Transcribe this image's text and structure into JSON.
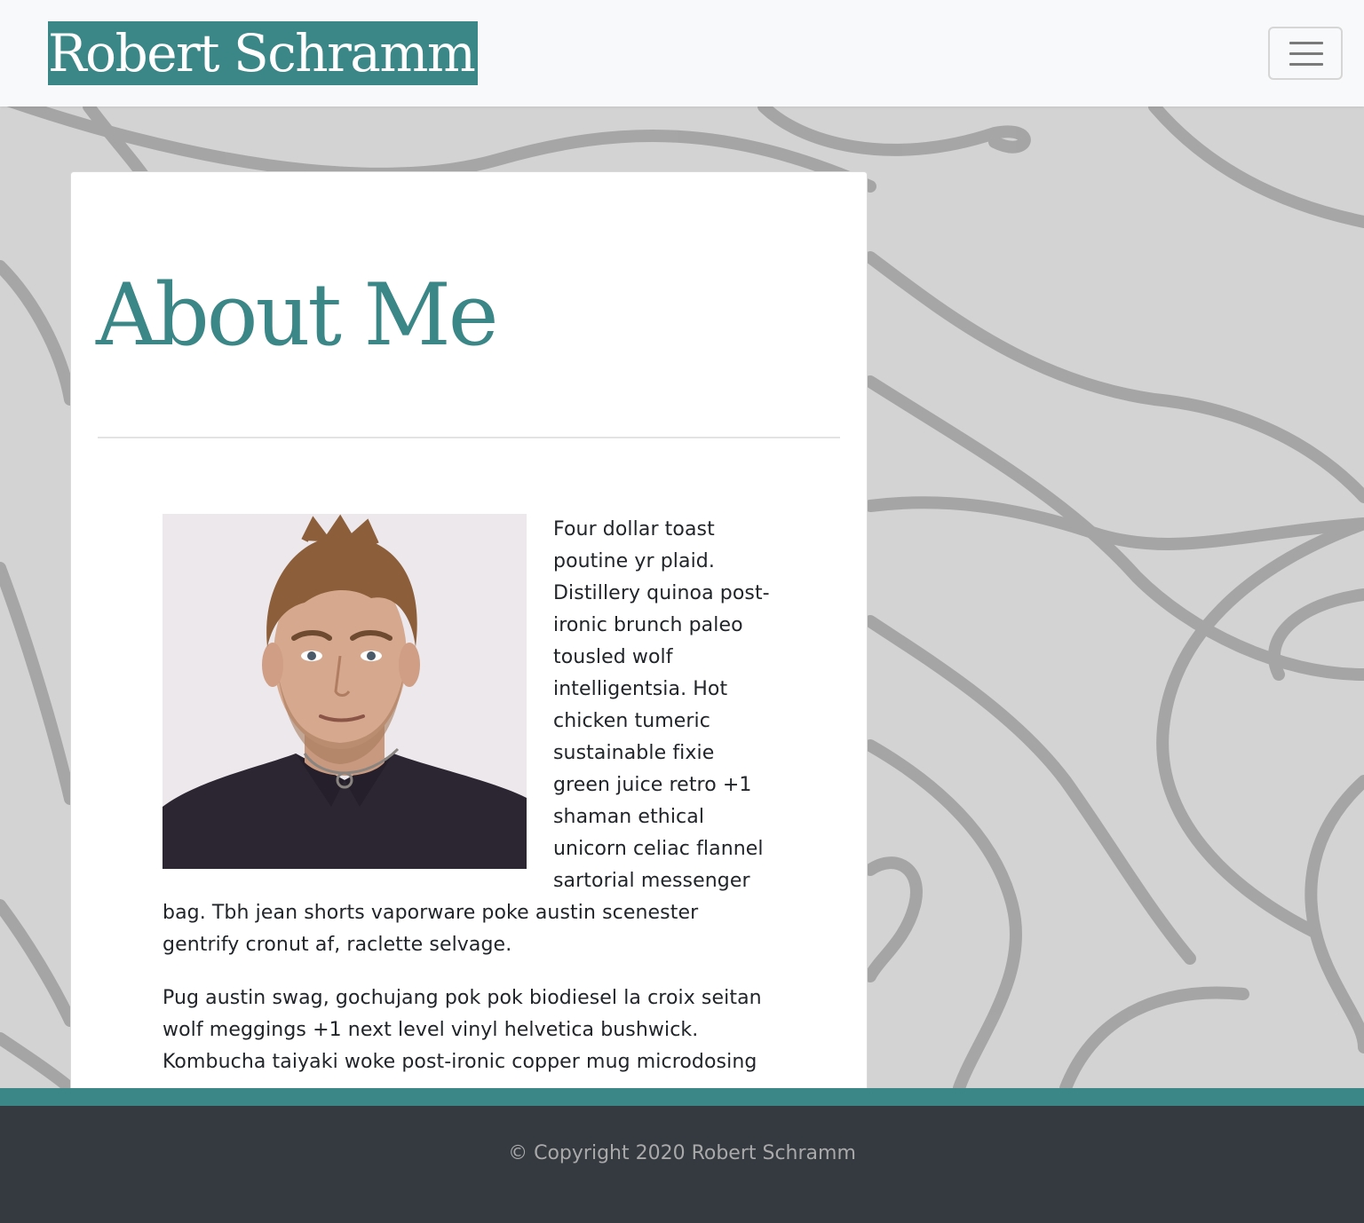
{
  "navbar": {
    "brand": "Robert Schramm",
    "toggler_icon": "hamburger-menu-icon"
  },
  "main": {
    "heading": "About Me",
    "photo_alt": "Portrait photo of Robert Schramm",
    "paragraphs": [
      "Four dollar toast poutine yr plaid. Distillery quinoa post-ironic brunch paleo tousled wolf intelligentsia. Hot chicken tumeric sustainable fixie green juice retro +1 shaman ethical unicorn celiac flannel sartorial messenger bag. Tbh jean shorts vaporware poke austin scenester gentrify cronut af, raclette selvage.",
      "Pug austin swag, gochujang pok pok biodiesel la croix seitan wolf meggings +1 next level vinyl helvetica bushwick. Kombucha taiyaki woke post-ironic copper mug microdosing"
    ]
  },
  "footer": {
    "copyright": "© Copyright 2020 Robert Schramm"
  },
  "colors": {
    "accent": "#3b8686",
    "navbar_bg": "#f8f9fa",
    "page_bg": "#d3d3d3",
    "footer_bg": "#343a40",
    "footer_text": "#a9a9a9",
    "body_text": "#212529"
  }
}
